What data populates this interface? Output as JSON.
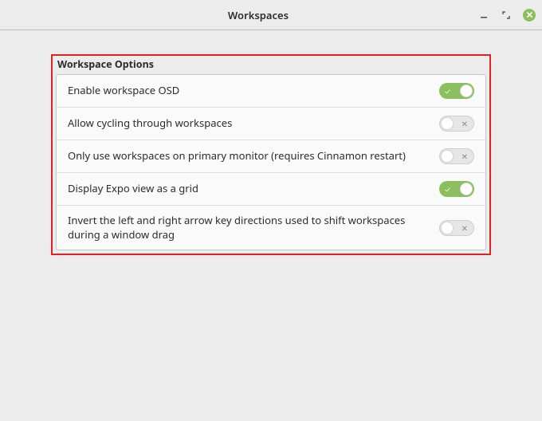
{
  "window": {
    "title": "Workspaces"
  },
  "group": {
    "title": "Workspace Options"
  },
  "options": [
    {
      "label": "Enable workspace OSD",
      "on": true
    },
    {
      "label": "Allow cycling through workspaces",
      "on": false
    },
    {
      "label": "Only use workspaces on primary monitor (requires Cinnamon restart)",
      "on": false
    },
    {
      "label": "Display Expo view as a grid",
      "on": true
    },
    {
      "label": "Invert the left and right arrow key directions used to shift workspaces during a window drag",
      "on": false
    }
  ],
  "colors": {
    "accent": "#8bbf5d",
    "highlight_box": "#e02222"
  }
}
